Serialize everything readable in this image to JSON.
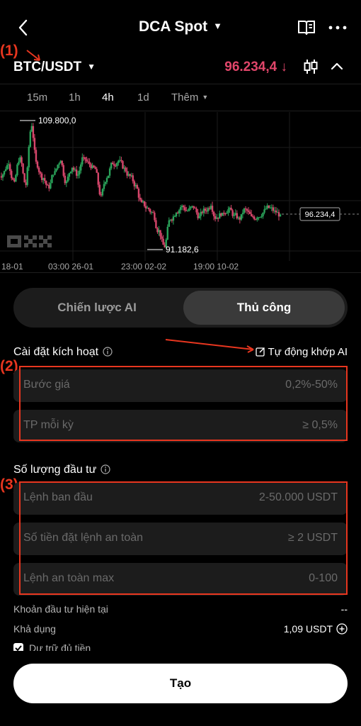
{
  "header": {
    "title": "DCA Spot"
  },
  "annotations": {
    "a1": "(1)",
    "a2": "(2)",
    "a3": "(3)"
  },
  "pair": {
    "symbol": "BTC/USDT",
    "price": "96.234,4",
    "price_arrow": "↓",
    "price_color": "#e0466a"
  },
  "timeframes": [
    {
      "label": "15m",
      "active": false
    },
    {
      "label": "1h",
      "active": false
    },
    {
      "label": "4h",
      "active": true
    },
    {
      "label": "1d",
      "active": false
    },
    {
      "label": "Thêm",
      "active": false
    }
  ],
  "chart_data": {
    "type": "candlestick",
    "high_label": "109.800,0",
    "low_label": "91.182,6",
    "last_label": "96.234,4",
    "x_ticks": [
      "18-01",
      "03:00 26-01",
      "23:00 02-02",
      "19:00 10-02"
    ],
    "closes": [
      102000,
      103500,
      101000,
      104500,
      100500,
      109000,
      103000,
      101500,
      100000,
      102500,
      104000,
      101000,
      103000,
      102000,
      104500,
      103500,
      102800,
      99000,
      101500,
      103500,
      104000,
      103000,
      101800,
      100500,
      98000,
      97200,
      96500,
      94000,
      91500,
      95500,
      96500,
      97500,
      96800,
      97200,
      96000,
      96800,
      97500,
      95800,
      96500,
      97000,
      96200,
      95500,
      97000,
      96000,
      95800,
      96500,
      97200,
      96800,
      96234
    ],
    "up_color": "#2aa35a",
    "down_color": "#d6466b"
  },
  "mode": {
    "ai_label": "Chiến lược AI",
    "manual_label": "Thủ công",
    "selected": "manual"
  },
  "trigger": {
    "title": "Cài đặt kích hoạt",
    "autofill": "Tự động khớp AI",
    "fields": [
      {
        "label": "Bước giá",
        "hint": "0,2%-50%"
      },
      {
        "label": "TP mỗi kỳ",
        "hint": "≥ 0,5%"
      }
    ]
  },
  "investment": {
    "title": "Số lượng đầu tư",
    "fields": [
      {
        "label": "Lệnh ban đầu",
        "hint": "2-50.000 USDT"
      },
      {
        "label": "Số tiền đặt lệnh an toàn",
        "hint": "≥ 2 USDT"
      },
      {
        "label": "Lệnh an toàn max",
        "hint": "0-100"
      }
    ]
  },
  "summary": {
    "current_label": "Khoản đầu tư hiện tại",
    "current_value": "--",
    "available_label": "Khả dụng",
    "available_value": "1,09 USDT",
    "reserve_label": "Dự trữ đủ tiền"
  },
  "footer": {
    "create_label": "Tạo"
  }
}
